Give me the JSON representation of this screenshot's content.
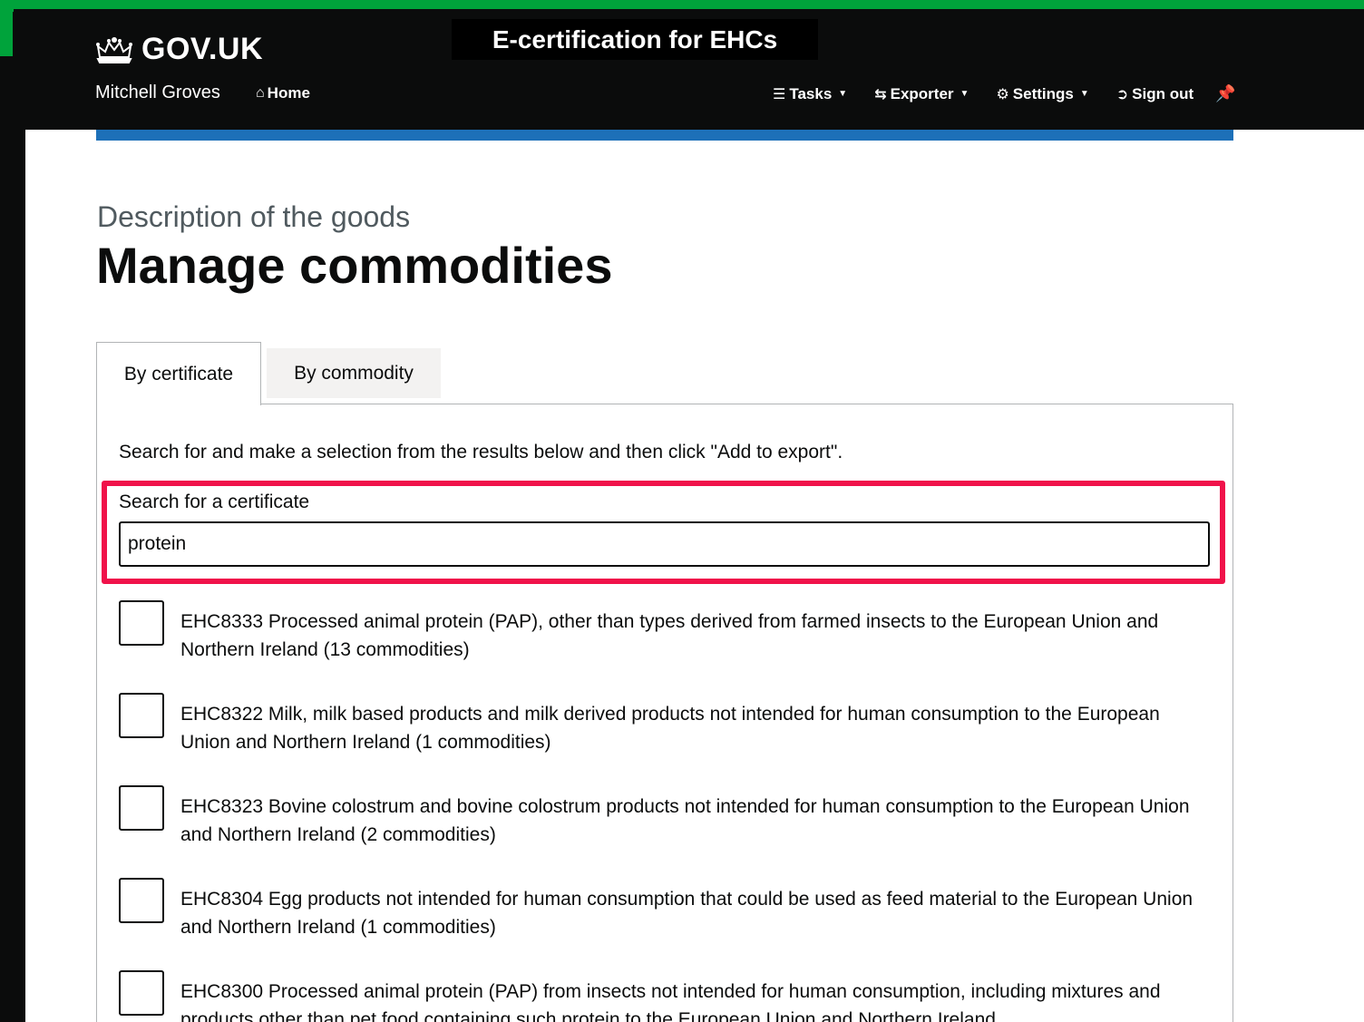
{
  "header": {
    "logo_text": "GOV.UK",
    "service_name": "E-certification for EHCs",
    "user_name": "Mitchell Groves",
    "nav": {
      "home": "Home",
      "tasks": "Tasks",
      "exporter": "Exporter",
      "settings": "Settings",
      "sign_out": "Sign out"
    }
  },
  "page": {
    "caption": "Description of the goods",
    "title": "Manage commodities"
  },
  "tabs": [
    {
      "label": "By certificate",
      "active": true
    },
    {
      "label": "By commodity",
      "active": false
    }
  ],
  "panel": {
    "instructions": "Search for and make a selection from the results below and then click \"Add to export\".",
    "search_label": "Search for a certificate",
    "search_value": "protein"
  },
  "results": [
    {
      "label": "EHC8333 Processed animal protein (PAP), other than types derived from farmed insects to the European Union and Northern Ireland (13 commodities)",
      "checked": false
    },
    {
      "label": "EHC8322 Milk, milk based products and milk derived products not intended for human consumption to the European Union and Northern Ireland (1 commodities)",
      "checked": false
    },
    {
      "label": "EHC8323 Bovine colostrum and bovine colostrum products not intended for human consumption to the European Union and Northern Ireland (2 commodities)",
      "checked": false
    },
    {
      "label": "EHC8304 Egg products not intended for human consumption that could be used as feed material to the European Union and Northern Ireland (1 commodities)",
      "checked": false
    },
    {
      "label": "EHC8300 Processed animal protein (PAP) from insects not intended for human consumption, including mixtures and products other than pet food containing such protein to the European Union and Northern Ireland",
      "checked": false
    }
  ],
  "colors": {
    "highlight": "#f0124a",
    "accent_blue": "#1d70b8",
    "green": "#00a33b"
  }
}
